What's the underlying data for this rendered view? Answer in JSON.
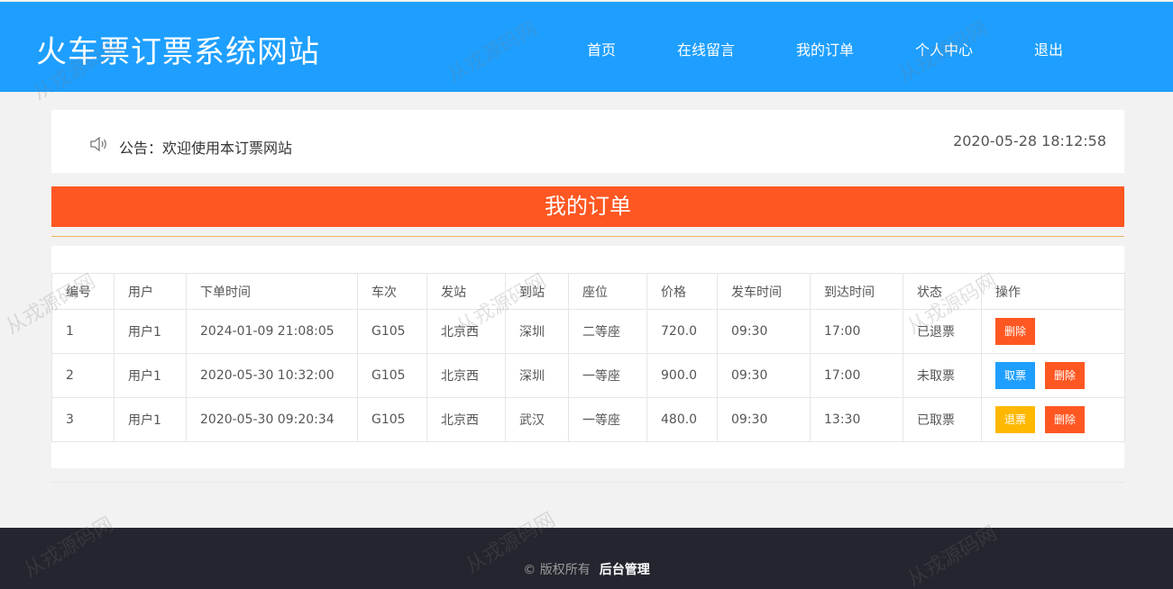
{
  "header": {
    "site_title": "火车票订票系统网站",
    "nav": [
      "首页",
      "在线留言",
      "我的订单",
      "个人中心",
      "退出"
    ]
  },
  "notice": {
    "icon": "speaker-icon",
    "label": "公告：",
    "text": "欢迎使用本订票网站",
    "datetime": "2020-05-28 18:12:58"
  },
  "section": {
    "title": "我的订单"
  },
  "orders": {
    "columns": [
      "编号",
      "用户",
      "下单时间",
      "车次",
      "发站",
      "到站",
      "座位",
      "价格",
      "发车时间",
      "到达时间",
      "状态",
      "操作"
    ],
    "rows": [
      {
        "id": "1",
        "user": "用户1",
        "order_time": "2024-01-09 21:08:05",
        "train": "G105",
        "from": "北京西",
        "to": "深圳",
        "seat": "二等座",
        "price": "720.0",
        "depart": "09:30",
        "arrive": "17:00",
        "status": "已退票",
        "actions": [
          "删除"
        ]
      },
      {
        "id": "2",
        "user": "用户1",
        "order_time": "2020-05-30 10:32:00",
        "train": "G105",
        "from": "北京西",
        "to": "深圳",
        "seat": "一等座",
        "price": "900.0",
        "depart": "09:30",
        "arrive": "17:00",
        "status": "未取票",
        "actions": [
          "取票",
          "删除"
        ]
      },
      {
        "id": "3",
        "user": "用户1",
        "order_time": "2020-05-30 09:20:34",
        "train": "G105",
        "from": "北京西",
        "to": "武汉",
        "seat": "一等座",
        "price": "480.0",
        "depart": "09:30",
        "arrive": "13:30",
        "status": "已取票",
        "actions": [
          "退票",
          "删除"
        ]
      }
    ]
  },
  "footer": {
    "copyright": "© 版权所有",
    "admin_link": "后台管理"
  },
  "watermark": "从戎源码网",
  "colors": {
    "header_bg": "#1e9fff",
    "section_bar": "#ff5722",
    "btn_delete": "#ff5722",
    "btn_pickup": "#1e9fff",
    "btn_refund": "#ffb800",
    "footer_bg": "#23262e"
  }
}
